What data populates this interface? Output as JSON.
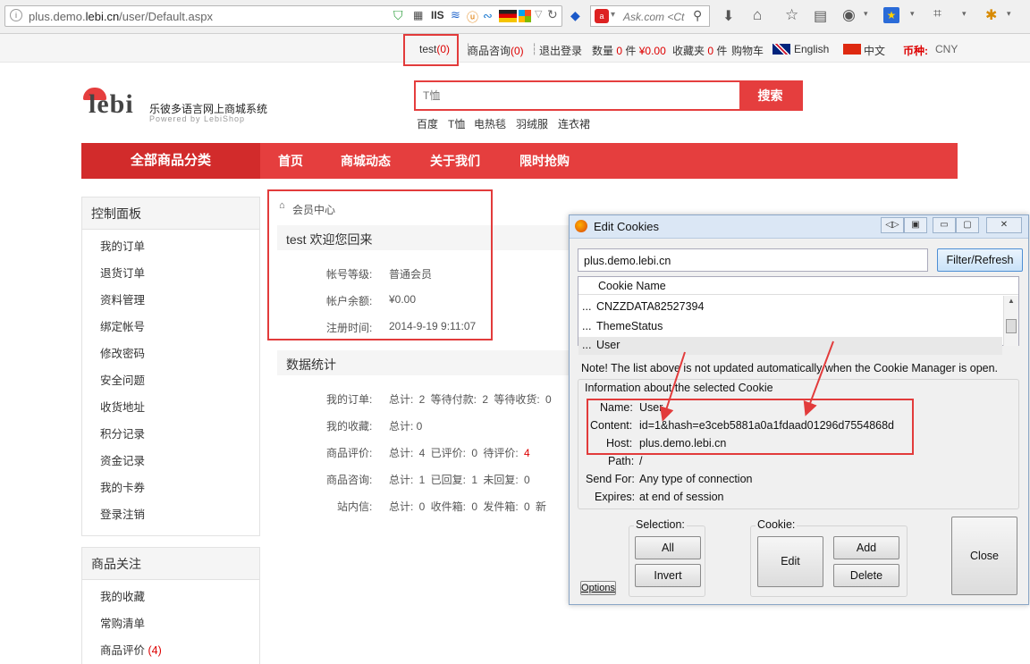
{
  "browser": {
    "url_prefix": "plus.demo.",
    "url_domain": "lebi.cn",
    "url_path": "/user/Default.aspx",
    "search_placeholder": "Ask.com <Ct"
  },
  "topbar": {
    "user": "test",
    "user_count": "(0)",
    "consult": "商品咨询",
    "consult_count": "(0)",
    "logout": "退出登录",
    "qty_label": "数量",
    "qty_value": "0",
    "qty_unit": "件",
    "amount": "¥0.00",
    "fav_label": "收藏夹",
    "fav_value": "0",
    "fav_unit": "件",
    "cart": "购物车",
    "lang_en": "English",
    "lang_zh": "中文",
    "currency_label": "币种:",
    "currency_value": "CNY"
  },
  "header": {
    "logo_text": "lebi",
    "logo_title": "乐彼多语言网上商城系统",
    "logo_sub": "Powered by LebiShop",
    "search_placeholder": "T恤",
    "search_button": "搜索",
    "hot_words": [
      "百度",
      "T恤",
      "电热毯",
      "羽绒服",
      "连衣裙"
    ]
  },
  "nav": {
    "all": "全部商品分类",
    "items": [
      "首页",
      "商城动态",
      "关于我们",
      "限时抢购"
    ]
  },
  "sidebar": {
    "panel_title": "控制面板",
    "panel_items": [
      "我的订单",
      "退货订单",
      "资料管理",
      "绑定帐号",
      "修改密码",
      "安全问题",
      "收货地址",
      "积分记录",
      "资金记录",
      "我的卡券",
      "登录注销"
    ],
    "follow_title": "商品关注",
    "follow_items": [
      "我的收藏",
      "常购清单",
      "商品评价"
    ],
    "follow_review_count": "(4)"
  },
  "member": {
    "breadcrumb": "会员中心",
    "welcome": "test 欢迎您回来",
    "level_label": "帐号等级:",
    "level_value": "普通会员",
    "balance_label": "帐户余额:",
    "balance_value": "¥0.00",
    "reg_label": "注册时间:",
    "reg_value": "2014-9-19 9:11:07"
  },
  "stats": {
    "title": "数据统计",
    "rows": [
      {
        "label": "我的订单:",
        "text": "总计: 2   等待付款: 2   等待收货: 0"
      },
      {
        "label": "我的收藏:",
        "text": "总计: 0"
      },
      {
        "label": "商品评价:",
        "text": "总计: 4   已评价: 0   待评价:",
        "extra": "4"
      },
      {
        "label": "商品咨询:",
        "text": "总计: 1   已回复: 1   未回复: 0"
      },
      {
        "label": "站内信:",
        "text": "总计: 0   收件箱: 0   发件箱: 0   新"
      }
    ]
  },
  "dialog": {
    "title": "Edit Cookies",
    "filter_value": "plus.demo.lebi.cn",
    "filter_button": "Filter/Refresh",
    "column": "Cookie Name",
    "cookies": [
      "CNZZDATA82527394",
      "ThemeStatus",
      "User"
    ],
    "note": "Note! The list above is not updated automatically when the Cookie Manager is open.",
    "info_title": "Information about the selected Cookie",
    "name_label": "Name:",
    "name_value": "User",
    "content_label": "Content:",
    "content_value": "id=1&hash=e3ceb5881a0a1fdaad01296d7554868d",
    "host_label": "Host:",
    "host_value": "plus.demo.lebi.cn",
    "path_label": "Path:",
    "path_value": "/",
    "sendfor_label": "Send For:",
    "sendfor_value": "Any type of connection",
    "expires_label": "Expires:",
    "expires_value": "at end of session",
    "selection_label": "Selection:",
    "all_button": "All",
    "invert_button": "Invert",
    "cookie_label": "Cookie:",
    "edit_button": "Edit",
    "add_button": "Add",
    "delete_button": "Delete",
    "close_button": "Close",
    "options_button": "Options"
  },
  "colors": {
    "brand_red": "#e53e3e",
    "highlight": "#e23b3b"
  }
}
